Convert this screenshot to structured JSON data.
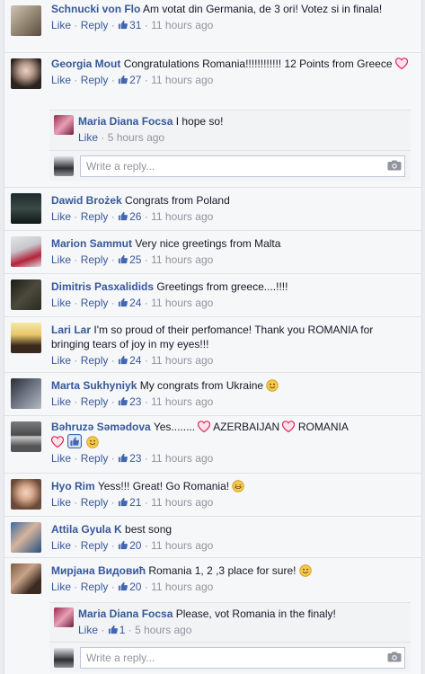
{
  "actions": {
    "like": "Like",
    "reply": "Reply",
    "sep": "·"
  },
  "comments": [
    {
      "author": "Schnucki von Flo",
      "text": "Am votat din Germania, de 3 ori! Votez si in finala!",
      "likes": "31",
      "time": "11 hours ago"
    },
    {
      "author": "Georgia Mout",
      "text": "Congratulations Romania!!!!!!!!!!!! 12 Points from Greece",
      "likes": "27",
      "time": "11 hours ago",
      "reply": {
        "author": "Maria Diana Focsa",
        "text": "I hope so!",
        "time": "5 hours ago"
      }
    },
    {
      "author": "Dawid Brożek",
      "text": "Congrats from Poland",
      "likes": "26",
      "time": "11 hours ago"
    },
    {
      "author": "Marion Sammut",
      "text": "Very nice greetings from Malta",
      "likes": "25",
      "time": "11 hours ago"
    },
    {
      "author": "Dimitris Pasxalidids",
      "text": "Greetings from greece....!!!!",
      "likes": "24",
      "time": "11 hours ago"
    },
    {
      "author": "Lari Lar",
      "text": "I'm so proud of their perfomance! Thank you ROMANIA for bringing tears of joy in my eyes!!!",
      "likes": "24",
      "time": "11 hours ago"
    },
    {
      "author": "Marta Sukhyniyk",
      "text": "My congrats from Ukraine",
      "likes": "23",
      "time": "11 hours ago"
    },
    {
      "author": "Bəhruzə Səmədova",
      "text_a": "Yes........",
      "text_b": "AZERBAIJAN",
      "text_c": "ROMANIA",
      "likes": "23",
      "time": "11 hours ago"
    },
    {
      "author": "Hyo Rim",
      "text": "Yess!!! Great! Go Romania!",
      "likes": "21",
      "time": "11 hours ago"
    },
    {
      "author": "Attila Gyula K",
      "text": "best song",
      "likes": "20",
      "time": "11 hours ago"
    },
    {
      "author": "Мирјана Видовић",
      "text": "Romania 1, 2 ,3 place for sure!",
      "likes": "20",
      "time": "11 hours ago",
      "reply": {
        "author": "Maria Diana Focsa",
        "text": "Please, vot Romania in the finaly!",
        "likes": "1",
        "time": "5 hours ago"
      }
    }
  ],
  "reply_box": {
    "placeholder": "Write a reply..."
  },
  "colors": {
    "link": "#365899",
    "meta": "#90949c",
    "heart": "#e0245e",
    "like_blue": "#4267b2",
    "smile": "#f7c948"
  },
  "icons": [
    "like-icon",
    "heart-icon",
    "smile-icon",
    "camera-icon"
  ]
}
